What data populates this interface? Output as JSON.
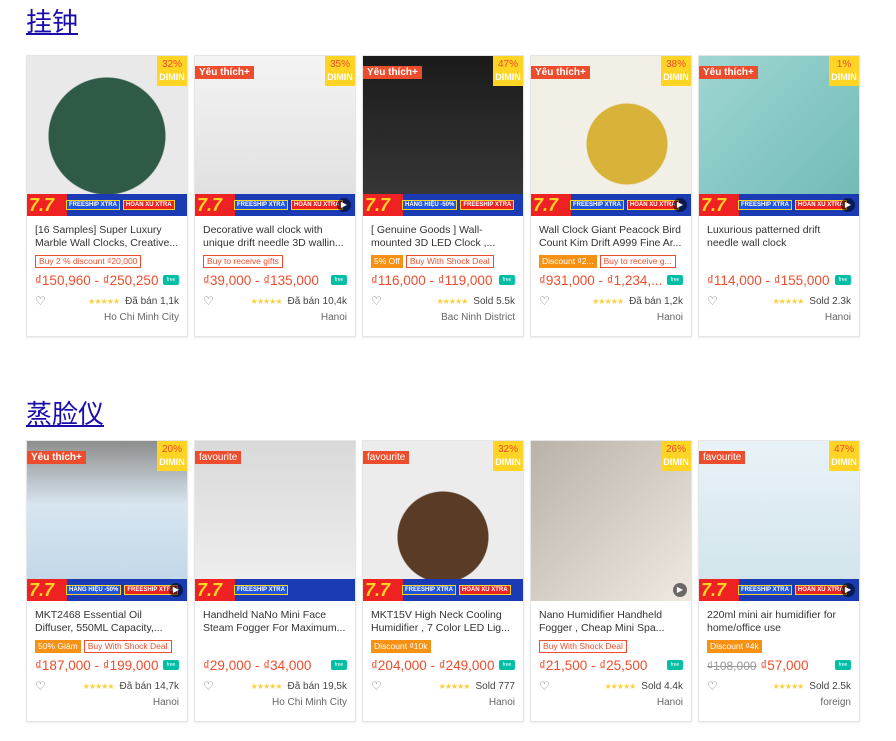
{
  "sections": [
    {
      "title": "挂钟",
      "cards": [
        {
          "name": "[16 Samples] Super Luxury Marble Wall Clocks, Creative...",
          "tag": "",
          "discount": "32%",
          "badges": [
            {
              "type": "out",
              "text": "Buy 2 % discount ₫20,000"
            }
          ],
          "price": "₫150,960 - ₫250,250",
          "old_price": "",
          "sold": "Đã bán 1,1k",
          "location": "Ho Chi Minh City",
          "promo": "7.7",
          "chips": [
            "FREESHIP XTRA",
            "HOÀN XU XTRA"
          ],
          "play": false
        },
        {
          "name": "Decorative wall clock with unique drift needle 3D wallin...",
          "tag": "Yêu thích+",
          "discount": "35%",
          "badges": [
            {
              "type": "out",
              "text": "Buy to receive gifts"
            }
          ],
          "price": "₫39,000 - ₫135,000",
          "old_price": "",
          "sold": "Đã bán 10,4k",
          "location": "Hanoi",
          "promo": "7.7",
          "chips": [
            "FREESHIP XTRA",
            "HOÀN XU XTRA"
          ],
          "play": true
        },
        {
          "name": "[ Genuine Goods ] Wall-mounted 3D LED Clock ,...",
          "tag": "Yêu thích+",
          "discount": "47%",
          "badges": [
            {
              "type": "fill",
              "text": "5% Off"
            },
            {
              "type": "out",
              "text": "Buy With Shock Deal"
            }
          ],
          "price": "₫116,000 - ₫119,000",
          "old_price": "",
          "sold": "Sold 5.5k",
          "location": "Bac Ninh District",
          "promo": "7.7",
          "chips": [
            "HÀNG HIỆU -50%",
            "FREESHIP XTRA"
          ],
          "play": false
        },
        {
          "name": "Wall Clock Giant Peacock Bird Count Kim Drift A999 Fine Ar...",
          "tag": "Yêu thích+",
          "discount": "38%",
          "badges": [
            {
              "type": "fill",
              "text": "Discount ₫2..."
            },
            {
              "type": "out",
              "text": "Buy to receive g..."
            }
          ],
          "price": "₫931,000 - ₫1,234,...",
          "old_price": "",
          "sold": "Đã bán 1,2k",
          "location": "Hanoi",
          "promo": "7.7",
          "chips": [
            "FREESHIP XTRA",
            "HOÀN XU XTRA"
          ],
          "play": true
        },
        {
          "name": "Luxurious patterned drift needle wall clock",
          "tag": "Yêu thích+",
          "discount": "1%",
          "badges": [],
          "price": "₫114,000 - ₫155,000",
          "old_price": "",
          "sold": "Sold 2.3k",
          "location": "Hanoi",
          "promo": "7.7",
          "chips": [
            "FREESHIP XTRA",
            "HOÀN XU XTRA"
          ],
          "play": true
        }
      ]
    },
    {
      "title": "蒸脸仪",
      "cards": [
        {
          "name": "MKT2468 Essential Oil Diffuser, 550ML Capacity,...",
          "tag": "Yêu thích+",
          "discount": "20%",
          "badges": [
            {
              "type": "fill",
              "text": "50% Giảm"
            },
            {
              "type": "out",
              "text": "Buy With Shock Deal"
            }
          ],
          "price": "₫187,000 - ₫199,000",
          "old_price": "",
          "sold": "Đã bán 14,7k",
          "location": "Hanoi",
          "promo": "7.7",
          "chips": [
            "HÀNG HIỆU -50%",
            "FREESHIP XTRA"
          ],
          "play": true
        },
        {
          "name": "Handheld NaNo Mini Face Steam Fogger For Maximum...",
          "tag": "favourite",
          "discount": "",
          "badges": [],
          "price": "₫29,000 - ₫34,000",
          "old_price": "",
          "sold": "Đã bán 19,5k",
          "location": "Ho Chi Minh City",
          "promo": "7.7",
          "chips": [
            "FREESHIP XTRA"
          ],
          "play": false
        },
        {
          "name": "MKT15V High Neck Cooling Humidifier , 7 Color LED Lig...",
          "tag": "favourite",
          "discount": "32%",
          "badges": [
            {
              "type": "fill",
              "text": "Discount ₫10k"
            }
          ],
          "price": "₫204,000 - ₫249,000",
          "old_price": "",
          "sold": "Sold 777",
          "location": "Hanoi",
          "promo": "7.7",
          "chips": [
            "FREESHIP XTRA",
            "HOÀN XU XTRA"
          ],
          "play": false
        },
        {
          "name": "Nano Humidifier Handheld Fogger , Cheap Mini Spa...",
          "tag": "",
          "discount": "26%",
          "badges": [
            {
              "type": "out",
              "text": "Buy With Shock Deal"
            }
          ],
          "price": "₫21,500 - ₫25,500",
          "old_price": "",
          "sold": "Sold 4.4k",
          "location": "Hanoi",
          "promo": "",
          "chips": [],
          "play": true
        },
        {
          "name": "220ml mini air humidifier for home/office use",
          "tag": "favourite",
          "discount": "47%",
          "badges": [
            {
              "type": "fill",
              "text": "Discount ₫4k"
            }
          ],
          "price": "₫57,000",
          "old_price": "₫108,000",
          "sold": "Sold 2.5k",
          "location": "foreign",
          "promo": "7.7",
          "chips": [
            "FREESHIP XTRA",
            "HOÀN XU XTRA"
          ],
          "play": true
        }
      ]
    }
  ],
  "discount_label": "DIMIN",
  "stars": "★★★★★",
  "heart": "♡",
  "truck_label": "free",
  "play_glyph": "▶"
}
